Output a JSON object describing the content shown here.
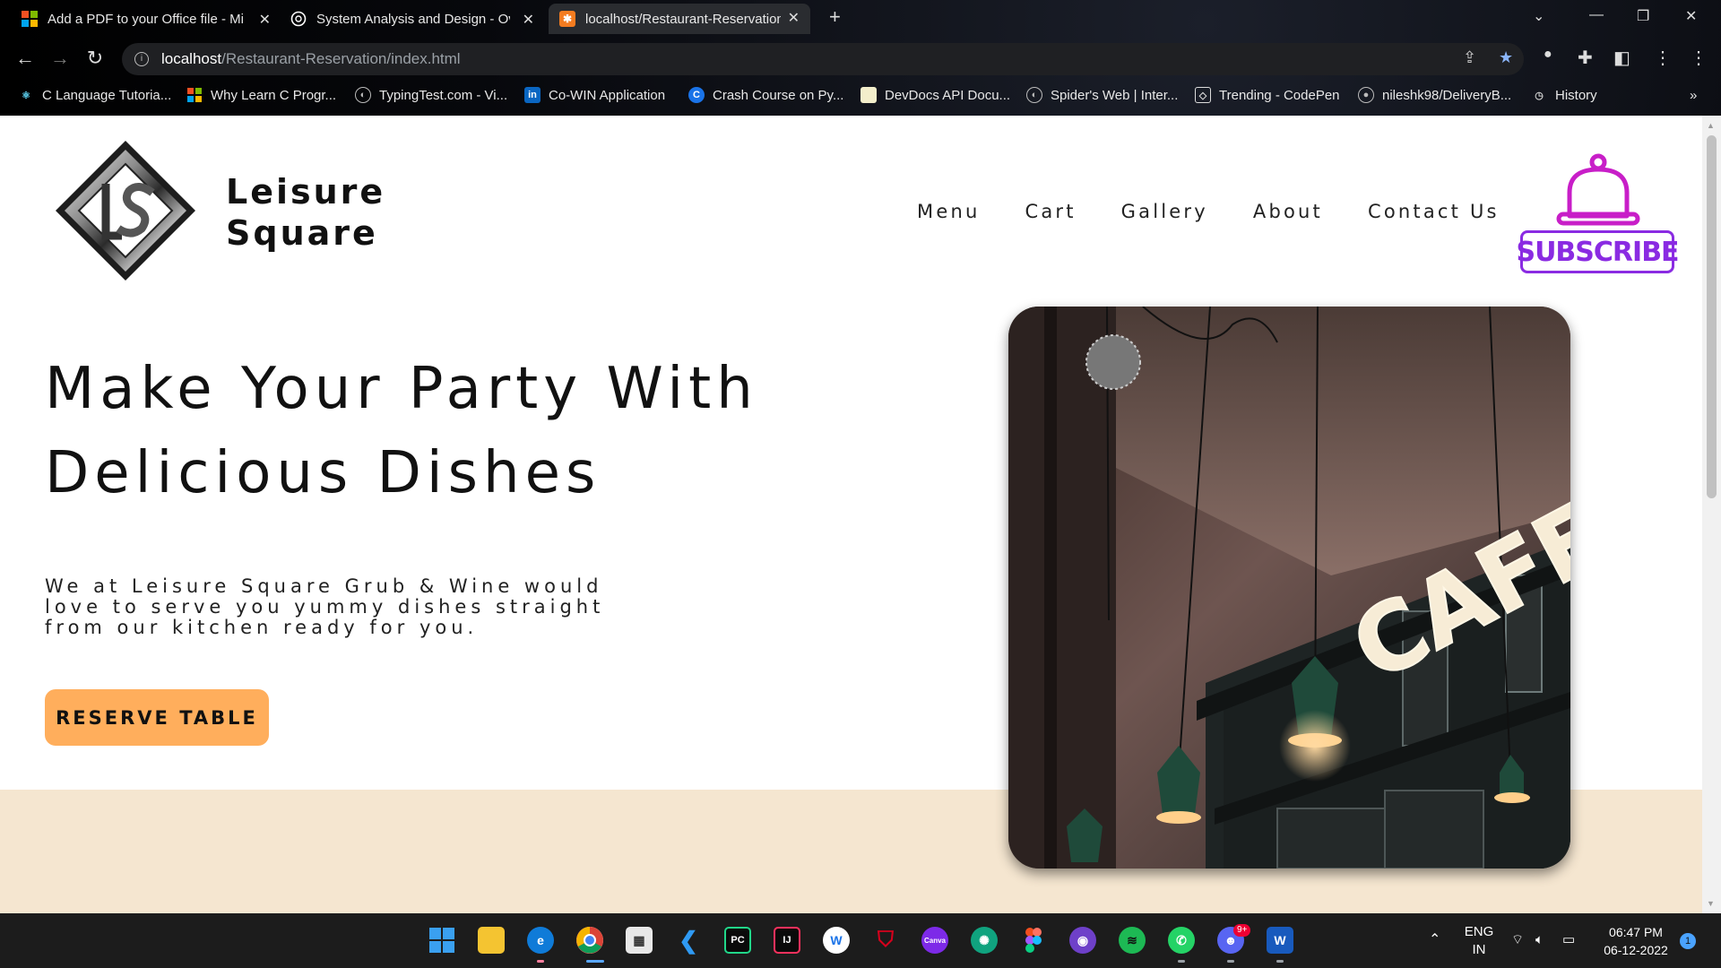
{
  "browser": {
    "tabs": [
      {
        "title": "Add a PDF to your Office file - Mi",
        "active": false
      },
      {
        "title": "System Analysis and Design - Ov",
        "active": false
      },
      {
        "title": "localhost/Restaurant-Reservation",
        "active": true
      }
    ],
    "new_tab": "+",
    "url_host": "localhost",
    "url_path": "/Restaurant-Reservation/index.html",
    "bookmarks": [
      "C Language Tutoria...",
      "Why Learn C Progr...",
      "TypingTest.com - Vi...",
      "Co-WIN Application",
      "Crash Course on Py...",
      "DevDocs API Docu...",
      "Spider's Web | Inter...",
      "Trending - CodePen",
      "nileshk98/DeliveryB...",
      "History"
    ],
    "bookmarks_more": "»"
  },
  "site": {
    "brand_line1": "Leisure",
    "brand_line2": "Square",
    "nav": [
      "Menu",
      "Cart",
      "Gallery",
      "About",
      "Contact Us"
    ],
    "subscribe_label": "SUBSCRIBE",
    "hero_line1": "Make Your Party With",
    "hero_line2": "Delicious Dishes",
    "hero_text": "We at Leisure Square Grub & Wine would love to serve you yummy dishes straight from our kitchen ready for you.",
    "reserve_label": "RESERVE TABLE",
    "photo_sign": "CAFE",
    "colors": {
      "accent": "#ffae5c",
      "subscribe": "#8a2be2",
      "band": "#f5e6d0"
    }
  },
  "taskbar": {
    "lang_top": "ENG",
    "lang_bottom": "IN",
    "time": "06:47 PM",
    "date": "06-12-2022",
    "notifications": "1",
    "discord_badge": "9+"
  }
}
